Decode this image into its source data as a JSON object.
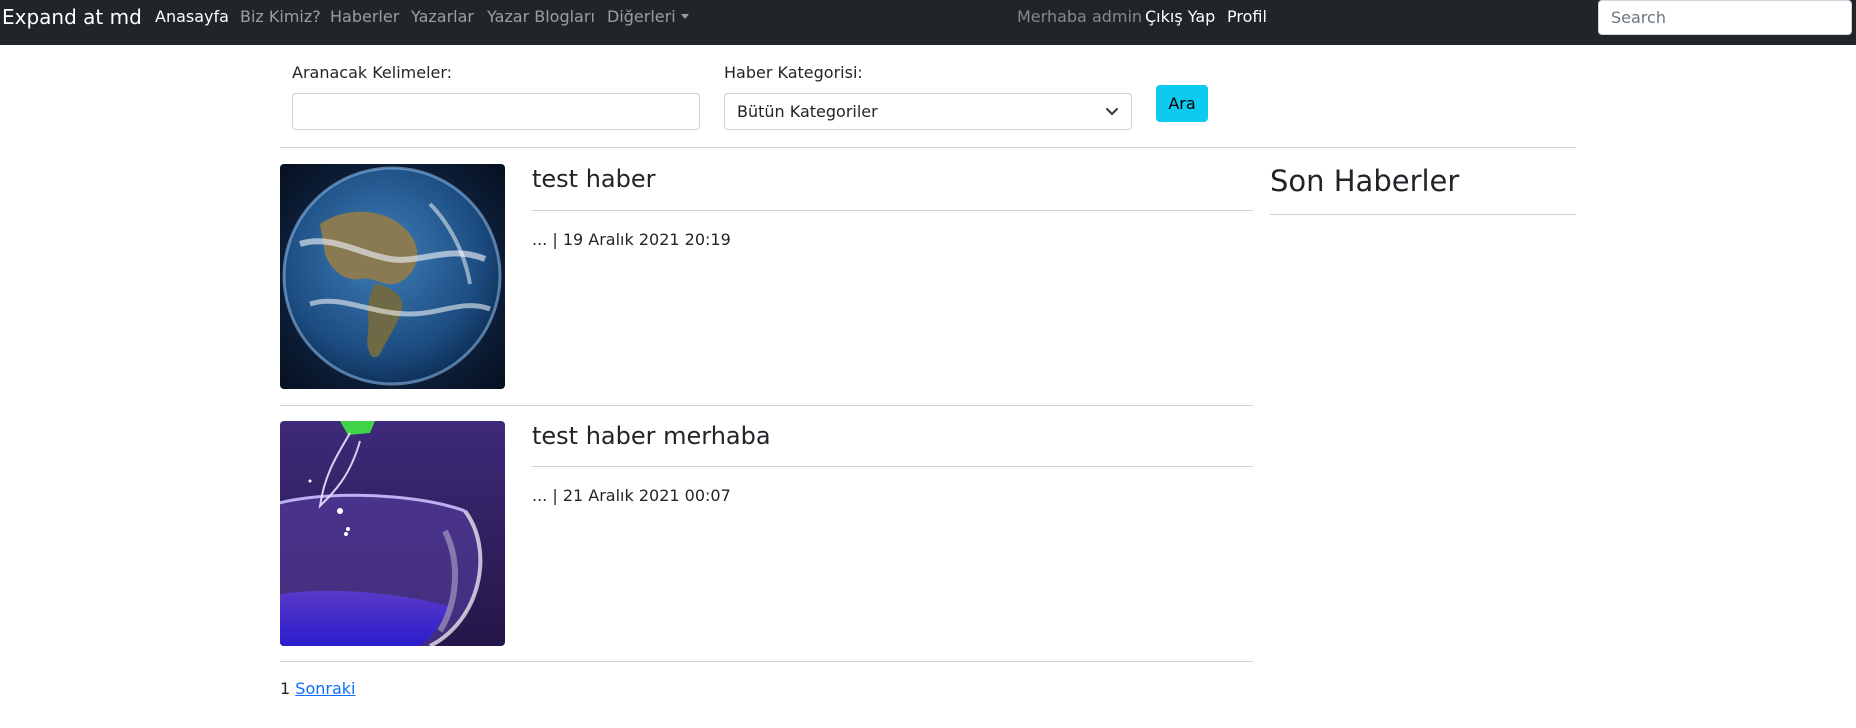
{
  "navbar": {
    "brand": "Expand at md",
    "links": [
      "Anasayfa",
      "Biz Kimiz?",
      "Haberler",
      "Yazarlar",
      "Yazar Blogları",
      "Diğerleri"
    ],
    "greeting": "Merhaba admin",
    "logout": "Çıkış Yap",
    "profile": "Profil",
    "search_placeholder": "Search"
  },
  "search_form": {
    "keywords_label": "Aranacak Kelimeler:",
    "keywords_value": "",
    "category_label": "Haber Kategorisi:",
    "category_selected": "Bütün Kategoriler",
    "submit_label": "Ara"
  },
  "news": [
    {
      "title": "test haber",
      "meta": "... | 19 Aralık 2021 20:19",
      "image": "earth-image"
    },
    {
      "title": "test haber merhaba",
      "meta": "... | 21 Aralık 2021 00:07",
      "image": "glass-image"
    }
  ],
  "sidebar": {
    "title": "Son Haberler"
  },
  "pagination": {
    "current": "1",
    "next": "Sonraki"
  },
  "colors": {
    "navbar": "#212529",
    "button": "#0dcaf0",
    "link": "#0d6efd"
  }
}
